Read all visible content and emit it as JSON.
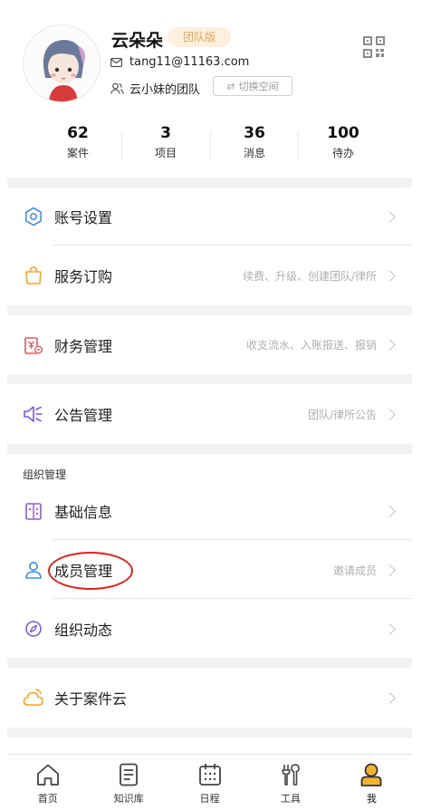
{
  "profile": {
    "name": "云朵朵",
    "badge": "团队版",
    "email": "tang11@11163.com",
    "team": "云小妹的团队",
    "switch_label": "切换空间"
  },
  "stats": [
    {
      "value": "62",
      "label": "案件"
    },
    {
      "value": "3",
      "label": "项目"
    },
    {
      "value": "36",
      "label": "消息"
    },
    {
      "value": "100",
      "label": "待办"
    }
  ],
  "menu": {
    "account": {
      "title": "账号设置"
    },
    "subscription": {
      "title": "服务订购",
      "sub": "续费、升级、创建团队/律所"
    },
    "finance": {
      "title": "财务管理",
      "sub": "收支流水、入账报送、报销"
    },
    "announcement": {
      "title": "公告管理",
      "sub": "团队/律所公告"
    },
    "org_section_label": "组织管理",
    "basic_info": {
      "title": "基础信息"
    },
    "members": {
      "title": "成员管理",
      "sub": "邀请成员"
    },
    "org_activity": {
      "title": "组织动态"
    },
    "about": {
      "title": "关于案件云"
    }
  },
  "tabbar": [
    {
      "label": "首页",
      "icon": "home-icon"
    },
    {
      "label": "知识库",
      "icon": "document-icon"
    },
    {
      "label": "日程",
      "icon": "calendar-icon"
    },
    {
      "label": "工具",
      "icon": "tools-icon"
    },
    {
      "label": "我",
      "icon": "profile-icon",
      "active": true
    }
  ],
  "colors": {
    "accent_orange": "#f5a623",
    "badge_bg": "#fdf0dd",
    "badge_text": "#e8a85a",
    "highlight_red": "#d9261c"
  }
}
